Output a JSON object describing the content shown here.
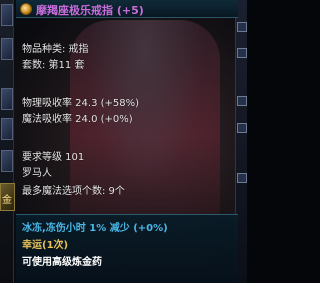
{
  "tooltip": {
    "title": "摩羯座极乐戒指 (+5)",
    "item_type": "物品种类: 戒指",
    "set": "套数: 第11 套",
    "physical_absorb": "物理吸收率 24.3 (+58%)",
    "magic_absorb": "魔法吸收率 24.0 (+0%)",
    "req_level": "要求等级 101",
    "req_race": "罗马人",
    "max_sockets": "最多魔法选项个数: 9个",
    "affix_1": "冰冻,冻伤小时 1% 减少 (+0%)",
    "affix_2": "幸运(1次)",
    "affix_3": "可使用高级炼金药"
  },
  "left_strip": {
    "gold_label": "金"
  },
  "colors": {
    "title": "#c76ddb",
    "stat": "#e6e6e6",
    "affix_blue": "#49b6e6",
    "affix_gold": "#e8c25a",
    "affix_white": "#ffffff"
  }
}
